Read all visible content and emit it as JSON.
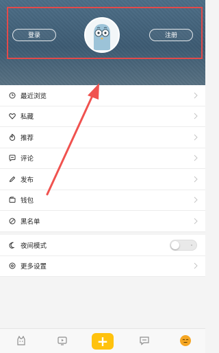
{
  "header": {
    "login_label": "登录",
    "register_label": "注册"
  },
  "menu": {
    "items": [
      {
        "label": "最近浏览",
        "icon": "clock-icon"
      },
      {
        "label": "私藏",
        "icon": "heart-icon"
      },
      {
        "label": "推荐",
        "icon": "flame-icon"
      },
      {
        "label": "评论",
        "icon": "comment-icon"
      },
      {
        "label": "发布",
        "icon": "pencil-icon"
      },
      {
        "label": "钱包",
        "icon": "wallet-icon"
      },
      {
        "label": "黑名单",
        "icon": "block-icon"
      }
    ]
  },
  "settings": {
    "night_mode_label": "夜间模式",
    "night_mode_on": false,
    "more_settings_label": "更多设置"
  },
  "tabbar": {
    "tabs": [
      "home-icon",
      "video-icon",
      "publish-plus-icon",
      "message-icon",
      "profile-icon"
    ],
    "plus_symbol": "+",
    "active_tab": "profile-icon",
    "accent_color": "#ffc20e"
  },
  "colors": {
    "header_bg": "#4d6e87",
    "annotation": "#e34a4a"
  }
}
